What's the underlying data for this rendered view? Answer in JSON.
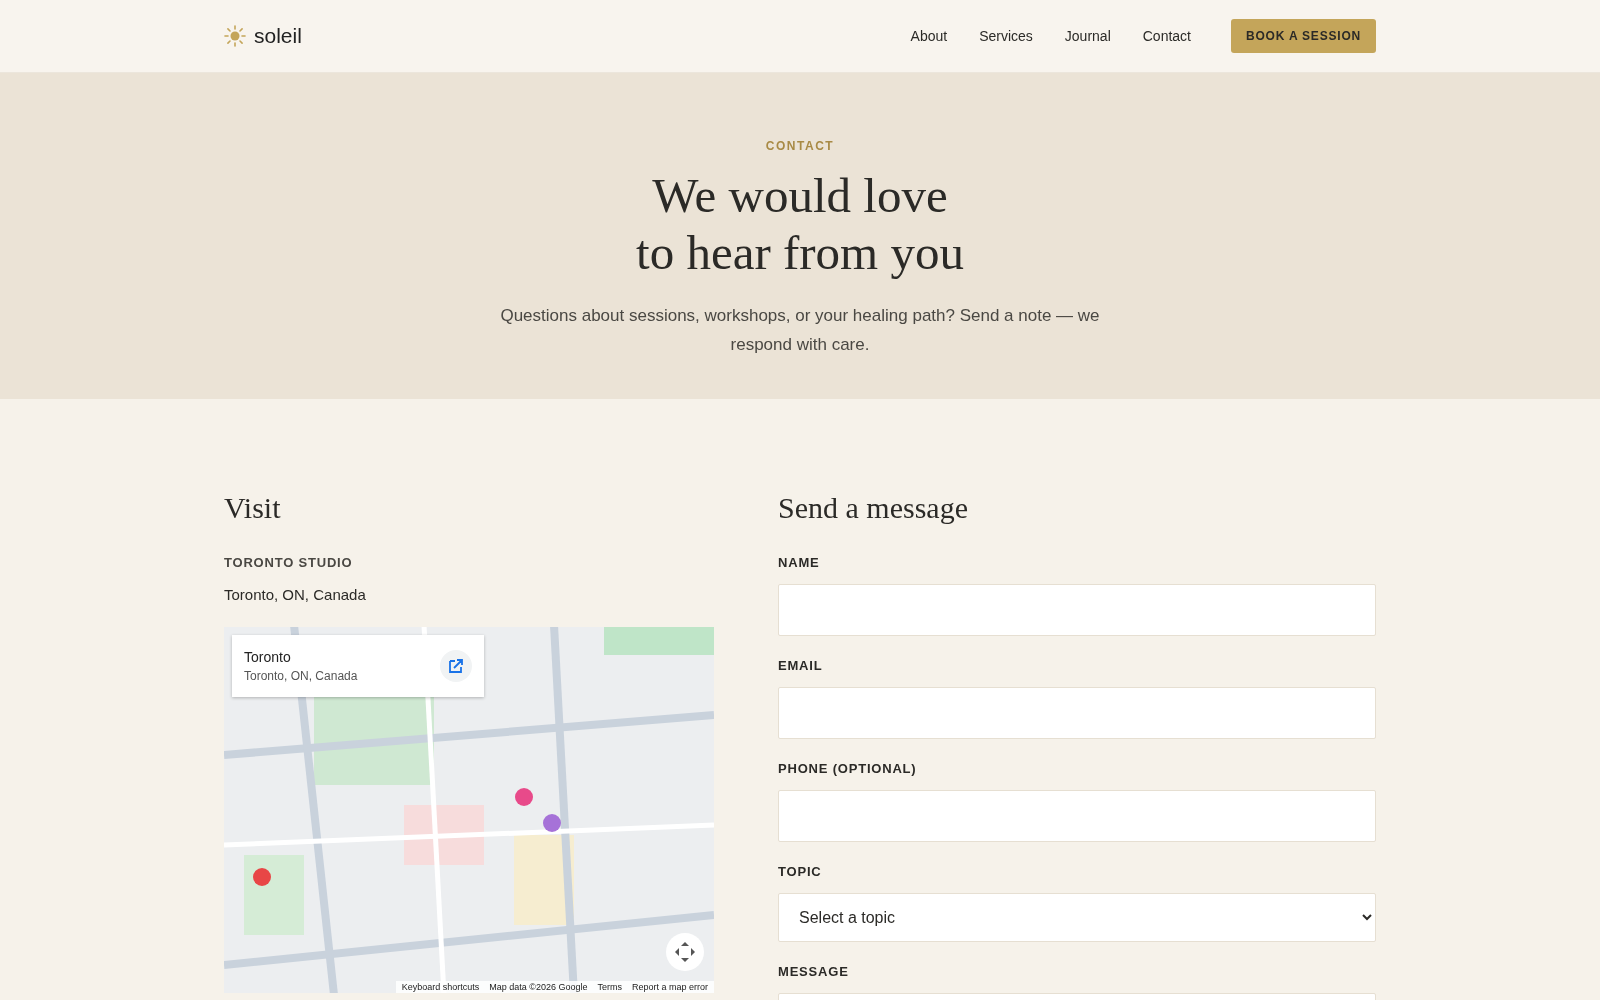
{
  "brand": {
    "name": "soleil"
  },
  "nav": [
    {
      "label": "About"
    },
    {
      "label": "Services"
    },
    {
      "label": "Journal"
    },
    {
      "label": "Contact"
    }
  ],
  "cta": {
    "label": "BOOK A SESSION"
  },
  "hero": {
    "eyebrow": "CONTACT",
    "title_lines": [
      "We would love",
      "to hear from you"
    ],
    "subtitle": "Questions about sessions, workshops, or your healing path? Send a note — we respond with care."
  },
  "visit": {
    "heading": "Visit",
    "studio_label": "TORONTO STUDIO",
    "address": "Toronto, ON, Canada",
    "map": {
      "kind": "picture",
      "card_title": "Toronto",
      "card_address": "Toronto, ON, Canada",
      "footer_links": [
        "Keyboard shortcuts",
        "Map data ©2026 Google",
        "Terms",
        "Report a map error"
      ]
    }
  },
  "form": {
    "heading": "Send a message",
    "fields": [
      {
        "kind": "input",
        "label": "NAME"
      },
      {
        "kind": "input",
        "label": "EMAIL"
      },
      {
        "kind": "input",
        "label": "PHONE (OPTIONAL)"
      },
      {
        "kind": "select",
        "label": "TOPIC",
        "placeholder": "Select a topic"
      },
      {
        "kind": "textarea",
        "label": "MESSAGE"
      }
    ]
  }
}
